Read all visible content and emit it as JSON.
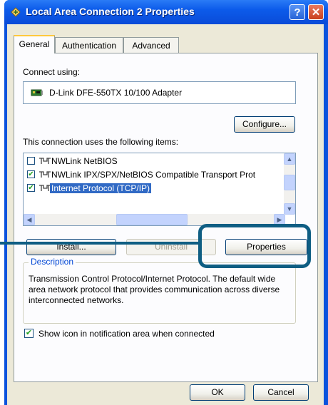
{
  "window": {
    "title": "Local Area Connection 2 Properties"
  },
  "titlebar": {
    "help_glyph": "?",
    "close_glyph": "✕"
  },
  "tabs": [
    {
      "label": "General",
      "active": true
    },
    {
      "label": "Authentication",
      "active": false
    },
    {
      "label": "Advanced",
      "active": false
    }
  ],
  "connect_using": {
    "label": "Connect using:",
    "adapter": "D-Link DFE-550TX 10/100 Adapter",
    "icon": "network-card-icon"
  },
  "configure_label": "Configure...",
  "items_label": "This connection uses the following items:",
  "items": [
    {
      "label": "NWLink NetBIOS",
      "checked": false,
      "selected": false
    },
    {
      "label": "NWLink IPX/SPX/NetBIOS Compatible Transport Prot",
      "checked": true,
      "selected": false
    },
    {
      "label": "Internet Protocol (TCP/IP)",
      "checked": true,
      "selected": true
    }
  ],
  "buttons": {
    "install": "Install...",
    "uninstall": "Uninstall",
    "properties": "Properties",
    "ok": "OK",
    "cancel": "Cancel"
  },
  "description": {
    "legend": "Description",
    "text": "Transmission Control Protocol/Internet Protocol. The default wide area network protocol that provides communication across diverse interconnected networks."
  },
  "show_icon": {
    "label": "Show icon in notification area when connected",
    "checked": true
  },
  "colors": {
    "titlebar": "#0c5bea",
    "selection": "#316ac5",
    "callout": "#0f5e83",
    "legend_text": "#0046d5"
  }
}
